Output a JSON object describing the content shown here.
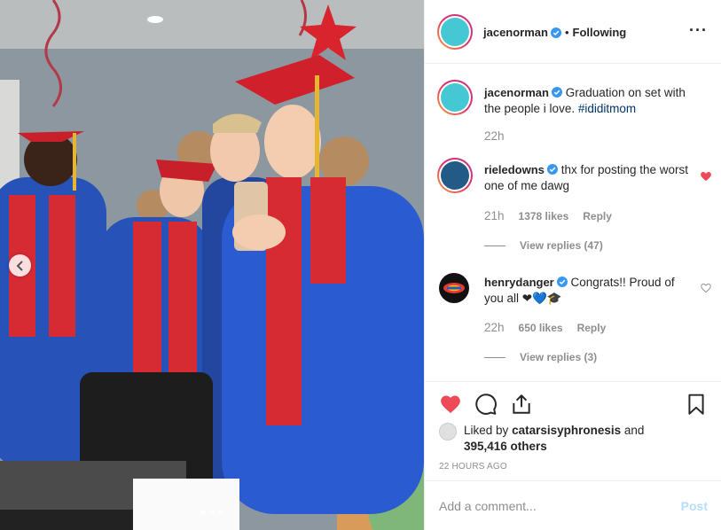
{
  "post": {
    "author": "jacenorman",
    "separator": "•",
    "follow_status": "Following",
    "more_icon": "more-horizontal-icon",
    "caption": {
      "username": "jacenorman",
      "text": "Graduation on set with the people i love.",
      "hashtag": "#ididitmom",
      "time": "22h"
    },
    "comments": [
      {
        "username": "rieledowns",
        "text": "thx for posting the worst one of me dawg",
        "time": "21h",
        "likes": "1378 likes",
        "reply": "Reply",
        "liked": true,
        "view_replies": "View replies (47)"
      },
      {
        "username": "henrydanger",
        "text": "Congrats!! Proud of you all",
        "emojis": "❤💙🎓",
        "time": "22h",
        "likes": "650 likes",
        "reply": "Reply",
        "liked": false,
        "view_replies": "View replies (3)"
      }
    ],
    "likes": {
      "prefix": "Liked by",
      "user": "catarsisyphronesis",
      "connector": "and",
      "others": "395,416 others"
    },
    "timestamp": "22 HOURS AGO",
    "comment_input": {
      "placeholder": "Add a comment...",
      "value": ""
    },
    "post_button": "Post",
    "carousel": {
      "total": 3,
      "active": 1
    }
  },
  "colors": {
    "heart_red": "#ed4956",
    "verified_blue": "#3897f0",
    "hashtag": "#003569",
    "muted": "#8e8e8e",
    "post_disabled": "#b2dffc",
    "gown_blue": "#2753b8",
    "stole_red": "#d72b34"
  }
}
